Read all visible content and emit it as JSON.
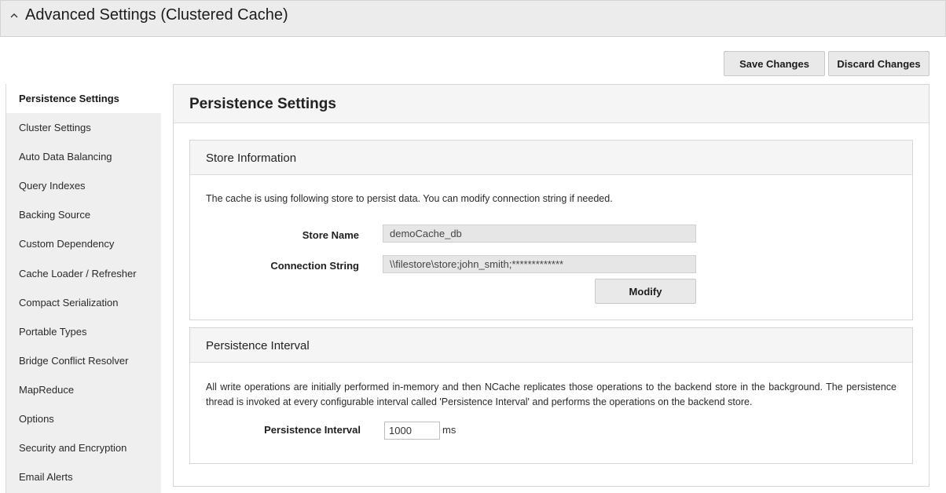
{
  "header": {
    "title": "Advanced Settings (Clustered Cache)",
    "collapse_icon": "chevron-up-icon"
  },
  "toolbar": {
    "save_label": "Save Changes",
    "discard_label": "Discard Changes"
  },
  "sidebar": {
    "active": "Persistence Settings",
    "items": [
      {
        "label": "Persistence Settings"
      },
      {
        "label": "Cluster Settings"
      },
      {
        "label": "Auto Data Balancing"
      },
      {
        "label": "Query Indexes"
      },
      {
        "label": "Backing Source"
      },
      {
        "label": "Custom Dependency"
      },
      {
        "label": "Cache Loader / Refresher"
      },
      {
        "label": "Compact Serialization"
      },
      {
        "label": "Portable Types"
      },
      {
        "label": "Bridge Conflict Resolver"
      },
      {
        "label": "MapReduce"
      },
      {
        "label": "Options"
      },
      {
        "label": "Security and Encryption"
      },
      {
        "label": "Email Alerts"
      }
    ]
  },
  "main": {
    "title": "Persistence Settings",
    "store_info": {
      "title": "Store Information",
      "description": "The cache is using following store to persist data. You can modify connection string if needed.",
      "store_name_label": "Store Name",
      "store_name_value": "demoCache_db",
      "connection_string_label": "Connection String",
      "connection_string_value": "\\\\filestore\\store;john_smith;*************",
      "modify_label": "Modify"
    },
    "interval": {
      "title": "Persistence Interval",
      "description": "All write operations are initially performed in-memory and then NCache replicates those operations to the backend store in the background. The persistence thread is invoked at every configurable interval called 'Persistence Interval' and performs the operations on the backend store.",
      "label": "Persistence Interval",
      "value": "1000",
      "unit": "ms"
    }
  },
  "colors": {
    "header_bg": "#ececec",
    "sidebar_bg": "#efefef",
    "button_bg": "#e9e9e9",
    "field_bg": "#e6e6e6"
  }
}
